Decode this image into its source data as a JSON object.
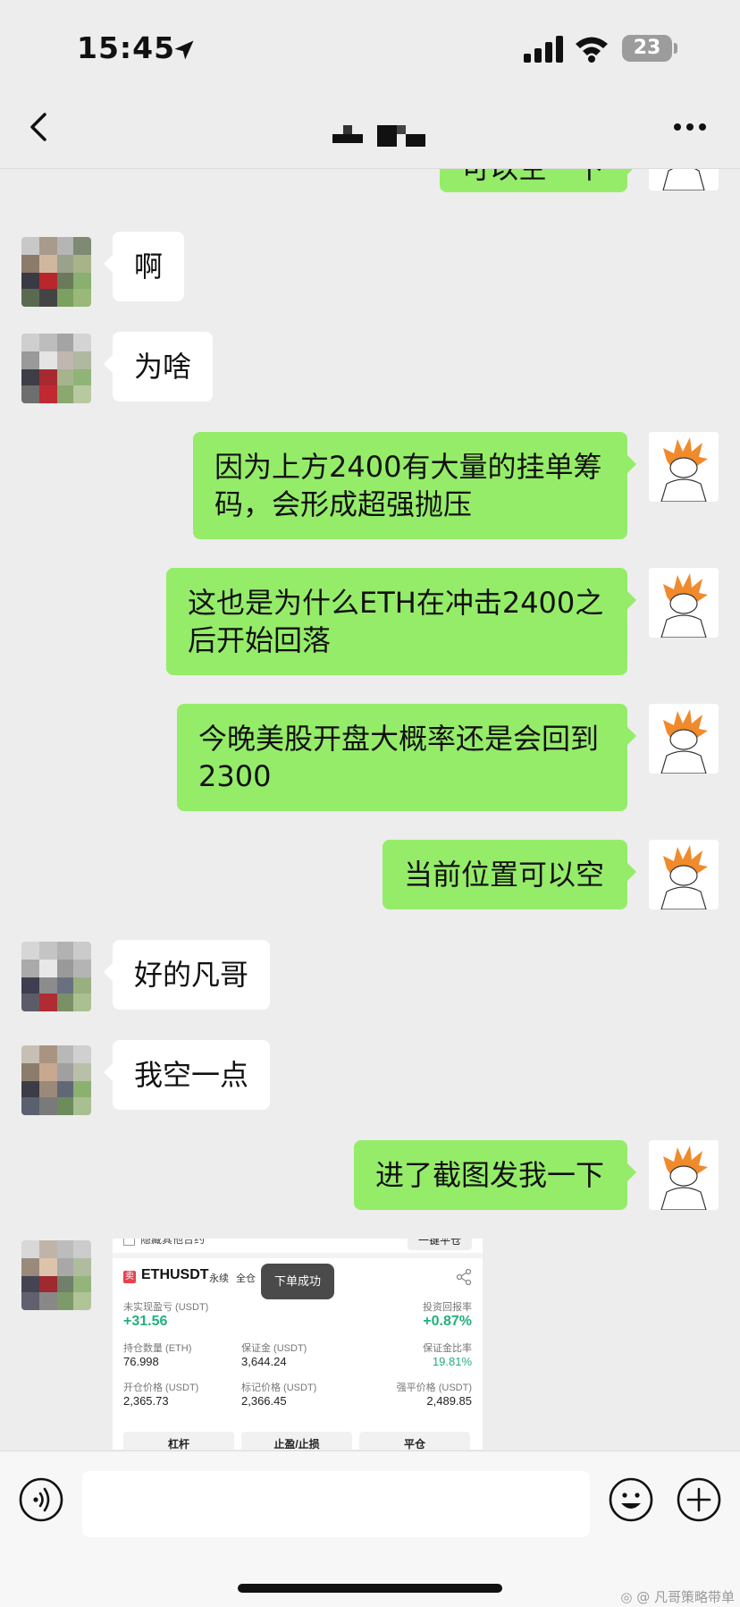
{
  "status": {
    "time": "15:45",
    "battery": "23"
  },
  "nav": {
    "title_hidden": true
  },
  "messages": [
    {
      "side": "out",
      "text": "可以空一下",
      "partial": true
    },
    {
      "side": "in",
      "text": "啊"
    },
    {
      "side": "in",
      "text": "为啥"
    },
    {
      "side": "out",
      "text": "因为上方2400有大量的挂单筹码，会形成超强抛压"
    },
    {
      "side": "out",
      "text": "这也是为什么ETH在冲击2400之后开始回落"
    },
    {
      "side": "out",
      "text": "今晚美股开盘大概率还是会回到2300"
    },
    {
      "side": "out",
      "text": "当前位置可以空"
    },
    {
      "side": "in",
      "text": "好的凡哥"
    },
    {
      "side": "in",
      "text": "我空一点"
    },
    {
      "side": "out",
      "text": "进了截图发我一下"
    }
  ],
  "screenshot": {
    "hide_other": "隐藏其他合约",
    "close_all": "一键平仓",
    "badge": "卖",
    "symbol": "ETHUSDT",
    "tag_perp": "永续",
    "tag_margin": "全仓",
    "toast": "下单成功",
    "unreal_label": "未实现盈亏 (USDT)",
    "unreal_value": "+31.56",
    "roi_label": "投资回报率",
    "roi_value": "+0.87%",
    "qty_label": "持仓数量 (ETH)",
    "qty_value": "76.998",
    "margin_label": "保证金 (USDT)",
    "margin_value": "3,644.24",
    "margin_ratio_label": "保证金比率",
    "margin_ratio_value": "19.81%",
    "entry_label": "开仓价格 (USDT)",
    "entry_value": "2,365.73",
    "mark_label": "标记价格 (USDT)",
    "mark_value": "2,366.45",
    "liq_label": "强平价格 (USDT)",
    "liq_value": "2,489.85",
    "btn_leverage": "杠杆",
    "btn_tpsl": "止盈/止损",
    "btn_close": "平仓"
  },
  "watermark": "凡哥策略带单",
  "colors": {
    "bubble_out": "#95ec69",
    "bubble_in": "#ffffff",
    "bg": "#ededed",
    "profit_green": "#22b07a"
  }
}
